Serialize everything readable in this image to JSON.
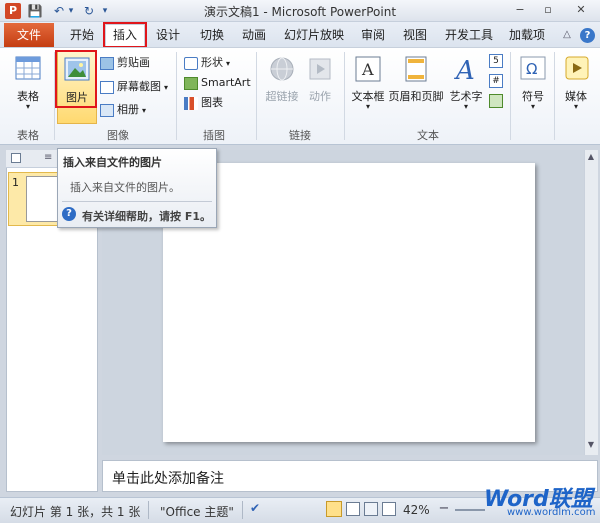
{
  "window": {
    "title": "演示文稿1 - Microsoft PowerPoint",
    "app_icon_letter": "P",
    "qa_save": "💾",
    "qa_undo": "↶",
    "qa_undo_arrow": "▾",
    "qa_redo": "↻",
    "qa_customize": "▾",
    "min_glyph": "−",
    "max_glyph": "▫",
    "close_glyph": "✕"
  },
  "ribbon_tabs": {
    "file": "文件",
    "home": "开始",
    "insert": "插入",
    "design": "设计",
    "transitions": "切换",
    "animations": "动画",
    "slideshow": "幻灯片放映",
    "review": "审阅",
    "view": "视图",
    "developer": "开发工具",
    "addins": "加载项",
    "minimize_glyph": "△",
    "help_glyph": "?"
  },
  "ribbon": {
    "table": {
      "label": "表格",
      "group": "表格"
    },
    "picture": {
      "label": "图片"
    },
    "clipart": "剪贴画",
    "screenshot": "屏幕截图",
    "album": "相册",
    "images_group": "图像",
    "shapes": "形状",
    "smartart": "SmartArt",
    "chart": "图表",
    "illustrations_group": "插图",
    "hyperlink": "超链接",
    "action": "动作",
    "links_group": "链接",
    "textbox": "文本框",
    "header_footer": "页眉和页脚",
    "wordart": "艺术字",
    "text_group": "文本",
    "symbols": "符号",
    "media": "媒体"
  },
  "tooltip": {
    "title": "插入来自文件的图片",
    "body": "插入来自文件的图片。",
    "help": "有关详细帮助，请按 F1。"
  },
  "slides_panel": {
    "first_slide_number": "1"
  },
  "notes": {
    "placeholder": "单击此处添加备注"
  },
  "statusbar": {
    "slide_info": "幻灯片 第 1 张，共 1 张",
    "theme": "\"Office 主题\"",
    "zoom": "42%",
    "minus": "−",
    "plus": "+"
  },
  "watermark": {
    "logo": "Word联盟",
    "url": "www.wordlm.com"
  },
  "colors": {
    "file_tab": "#c43d12",
    "highlight_box": "#e0161b",
    "watermark": "#1e64c8"
  }
}
